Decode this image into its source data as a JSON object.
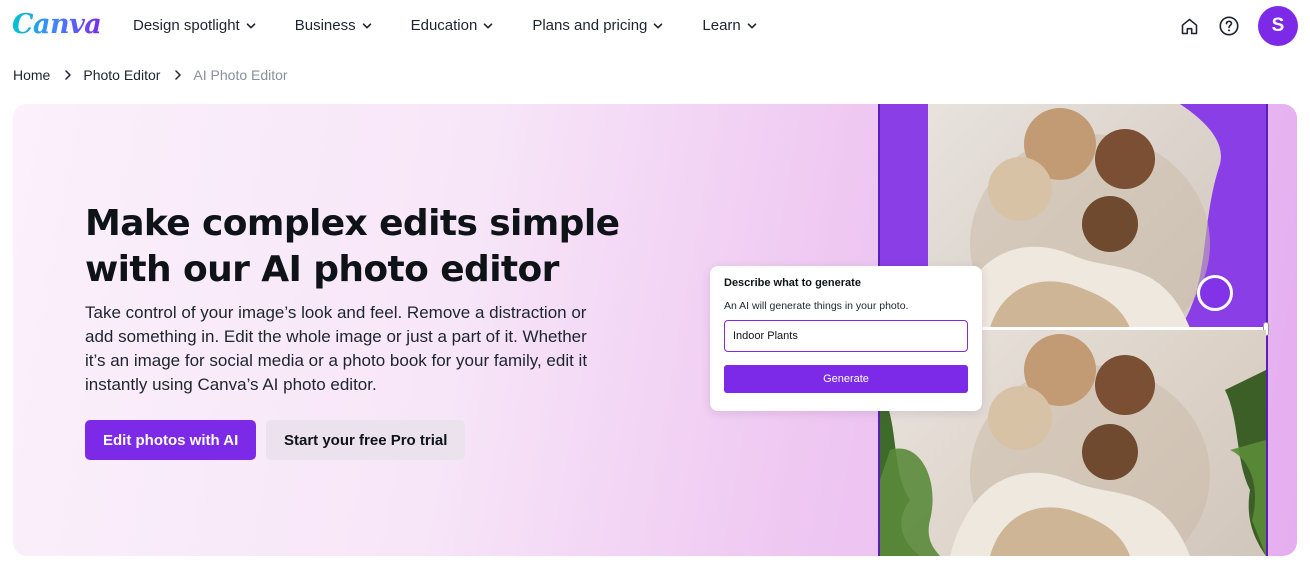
{
  "nav": {
    "logo": "Canva",
    "items": [
      {
        "label": "Design spotlight"
      },
      {
        "label": "Business"
      },
      {
        "label": "Education"
      },
      {
        "label": "Plans and pricing"
      },
      {
        "label": "Learn"
      }
    ],
    "icons": [
      "home-icon",
      "help-icon"
    ],
    "avatar_initial": "S"
  },
  "breadcrumb": {
    "items": [
      "Home",
      "Photo Editor",
      "AI Photo Editor"
    ]
  },
  "hero": {
    "title": "Make complex edits simple with our AI photo editor",
    "description": "Take control of your image’s look and feel. Remove a distraction or add something in. Edit the whole image or just a part of it. Whether it’s an image for social media or a photo book for your family, edit it instantly using Canva’s AI photo editor.",
    "primary_button": "Edit photos with AI",
    "secondary_button": "Start your free Pro trial"
  },
  "generate_panel": {
    "title": "Describe what to generate",
    "subtitle": "An AI will generate things in your photo.",
    "input_value": "Indoor Plants",
    "button": "Generate"
  },
  "colors": {
    "brand_purple": "#7d2ae8",
    "hero_bg_start": "#fbf0fb",
    "hero_bg_end": "#e5aef0",
    "secondary_button_bg": "#ebe2ee"
  }
}
